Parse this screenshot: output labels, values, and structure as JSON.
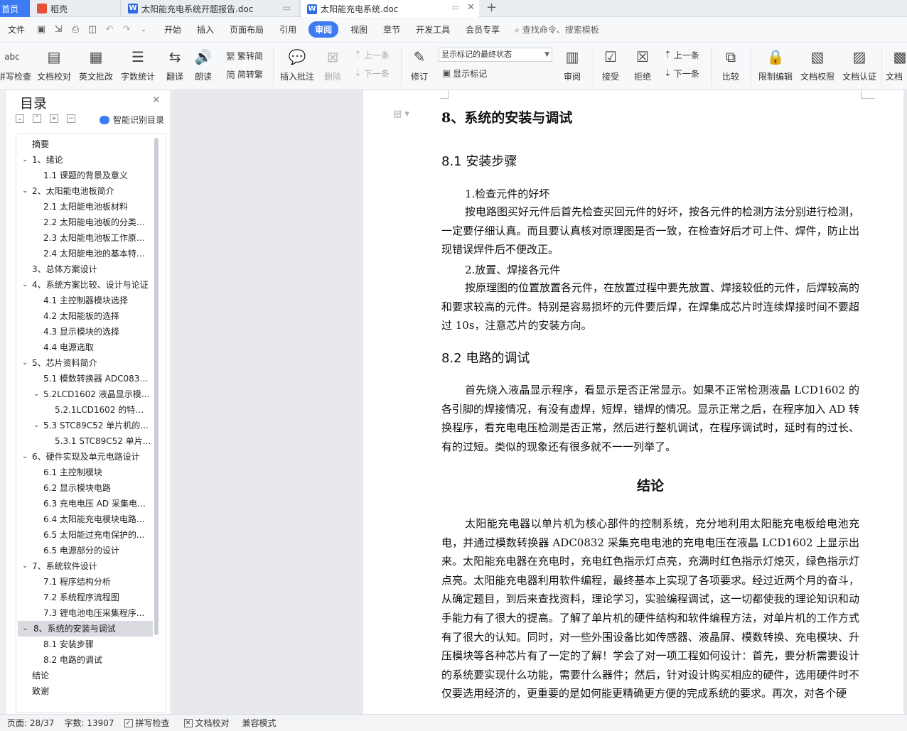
{
  "tabs": {
    "home": "首页",
    "items": [
      {
        "label": "稻壳"
      },
      {
        "label": "太阳能充电系统开题报告.doc"
      },
      {
        "label": "太阳能充电系统.doc"
      }
    ]
  },
  "menu": {
    "file": "文件",
    "items": [
      "开始",
      "插入",
      "页面布局",
      "引用",
      "审阅",
      "视图",
      "章节",
      "开发工具",
      "会员专享"
    ],
    "active": "审阅",
    "search": "查找命令、搜索模板"
  },
  "ribbon": {
    "spell_check": "拼写检查",
    "spell_abc": "abc",
    "doc_check": "文档校对",
    "eng_review": "英文批改",
    "word_count": "字数统计",
    "translate": "翻译",
    "read_aloud": "朗读",
    "trad": "繁转简",
    "simp": "简转繁",
    "insert_comment": "插入批注",
    "delete": "删除",
    "prev_comment": "上一条",
    "next_comment": "下一条",
    "revise": "修订",
    "mark_state": "显示标记的最终状态",
    "show_marks": "显示标记",
    "review": "审阅",
    "accept": "接受",
    "reject": "拒绝",
    "prev_change": "上一条",
    "next_change": "下一条",
    "compare": "比较",
    "restrict_edit": "限制编辑",
    "doc_rights": "文档权限",
    "doc_cert": "文档认证",
    "doc_more": "文档"
  },
  "nav": {
    "title": "目录",
    "smart": "智能识别目录",
    "items": [
      {
        "label": "摘要",
        "level": 0,
        "exp": false
      },
      {
        "label": "1、绪论",
        "level": 0,
        "exp": true
      },
      {
        "label": "1.1 课题的背景及意义",
        "level": 1,
        "exp": false
      },
      {
        "label": "2、太阳能电池板简介",
        "level": 0,
        "exp": true
      },
      {
        "label": "2.1 太阳能电池板材料",
        "level": 1,
        "exp": false
      },
      {
        "label": "2.2 太阳能电池板的分类及...",
        "level": 1,
        "exp": false
      },
      {
        "label": "2.3 太阳能电池板工作原理...",
        "level": 1,
        "exp": false
      },
      {
        "label": "2.4 太阳能电池的基本特性...",
        "level": 1,
        "exp": false
      },
      {
        "label": "3、总体方案设计",
        "level": 0,
        "exp": false
      },
      {
        "label": "4、系统方案比较、设计与论证",
        "level": 0,
        "exp": true
      },
      {
        "label": "4.1 主控制器模块选择",
        "level": 1,
        "exp": false
      },
      {
        "label": "4.2 太阳能板的选择",
        "level": 1,
        "exp": false
      },
      {
        "label": "4.3 显示模块的选择",
        "level": 1,
        "exp": false
      },
      {
        "label": "4.4 电源选取",
        "level": 1,
        "exp": false
      },
      {
        "label": "5、芯片资料简介",
        "level": 0,
        "exp": true
      },
      {
        "label": "5.1 模数转换器 ADC0832...",
        "level": 1,
        "exp": false
      },
      {
        "label": "5.2LCD1602 液晶显示模块...",
        "level": 1,
        "exp": true
      },
      {
        "label": "5.2.1LCD1602 的特性...",
        "level": 2,
        "exp": false
      },
      {
        "label": "5.3 STC89C52 单片机的...",
        "level": 1,
        "exp": true
      },
      {
        "label": "5.3.1 STC89C52 单片...",
        "level": 2,
        "exp": false
      },
      {
        "label": "6、硬件实现及单元电路设计",
        "level": 0,
        "exp": true
      },
      {
        "label": "6.1 主控制模块",
        "level": 1,
        "exp": false
      },
      {
        "label": "6.2 显示模块电路",
        "level": 1,
        "exp": false
      },
      {
        "label": "6.3 充电电压 AD 采集电路...",
        "level": 1,
        "exp": false
      },
      {
        "label": "6.4 太阳能充电模块电路...",
        "level": 1,
        "exp": false
      },
      {
        "label": "6.5 太阳能过充电保护的...",
        "level": 1,
        "exp": false
      },
      {
        "label": "6.5 电源部分的设计",
        "level": 1,
        "exp": false
      },
      {
        "label": "7、系统软件设计",
        "level": 0,
        "exp": true
      },
      {
        "label": "7.1 程序结构分析",
        "level": 1,
        "exp": false
      },
      {
        "label": "7.2 系统程序流程图",
        "level": 1,
        "exp": false
      },
      {
        "label": "7.3 锂电池电压采集程序...",
        "level": 1,
        "exp": false
      },
      {
        "label": "8、系统的安装与调试",
        "level": 0,
        "exp": true,
        "selected": true
      },
      {
        "label": "8.1 安装步骤",
        "level": 1,
        "exp": false
      },
      {
        "label": "8.2 电路的调试",
        "level": 1,
        "exp": false
      },
      {
        "label": "结论",
        "level": 0,
        "exp": false
      },
      {
        "label": "致谢",
        "level": 0,
        "exp": false
      }
    ]
  },
  "doc": {
    "h1": "8、系统的安装与调试",
    "s81_num": "8.1",
    "s81_title": "安装步骤",
    "step1": "1.检查元件的好坏",
    "p1": "按电路图买好元件后首先检查买回元件的好坏，按各元件的检测方法分别进行检测，一定要仔细认真。而且要认真核对原理图是否一致，在检查好后才可上件、焊件，防止出现错误焊件后不便改正。",
    "step2": "2.放置、焊接各元件",
    "p2": "按原理图的位置放置各元件，在放置过程中要先放置、焊接较低的元件，后焊较高的和要求较高的元件。特别是容易损坏的元件要后焊，在焊集成芯片时连续焊接时间不要超过 10s，注意芯片的安装方向。",
    "s82_num": "8.2",
    "s82_title": "电路的调试",
    "p3": "首先烧入液晶显示程序，看显示是否正常显示。如果不正常检测液晶 LCD1602 的各引脚的焊接情况，有没有虚焊，短焊，错焊的情况。显示正常之后，在程序加入 AD 转换程序，看充电电压检测是否正常，然后进行整机调试，在程序调试时，延时有的过长、有的过短。类似的现象还有很多就不一一列举了。",
    "conclusion_title": "结论",
    "p4": "太阳能充电器以单片机为核心部件的控制系统，充分地利用太阳能充电板给电池充电，并通过模数转换器 ADC0832 采集充电电池的充电电压在液晶 LCD1602 上显示出来。太阳能充电器在充电时，充电红色指示灯点亮，充满时红色指示灯熄灭，绿色指示灯点亮。太阳能充电器利用软件编程，最终基本上实现了各项要求。经过近两个月的奋斗，从确定题目，到后来查找资料，理论学习，实验编程调试，这一切都使我的理论知识和动手能力有了很大的提高。了解了单片机的硬件结构和软件编程方法，对单片机的工作方式有了很大的认知。同时，对一些外围设备比如传感器、液晶屏、模数转换、充电模块、升压模块等各种芯片有了一定的了解！学会了对一项工程如何设计：首先，要分析需要设计的系统要实现什么功能，需要什么器件；然后，针对设计购买相应的硬件，选用硬件时不仅要选用经济的，更重要的是如何能更精确更方便的完成系统的要求。再次，对各个硬"
  },
  "status": {
    "page": "页面: 28/37",
    "words": "字数: 13907",
    "spell": "拼写检查",
    "proof": "文档校对",
    "compat": "兼容模式"
  }
}
